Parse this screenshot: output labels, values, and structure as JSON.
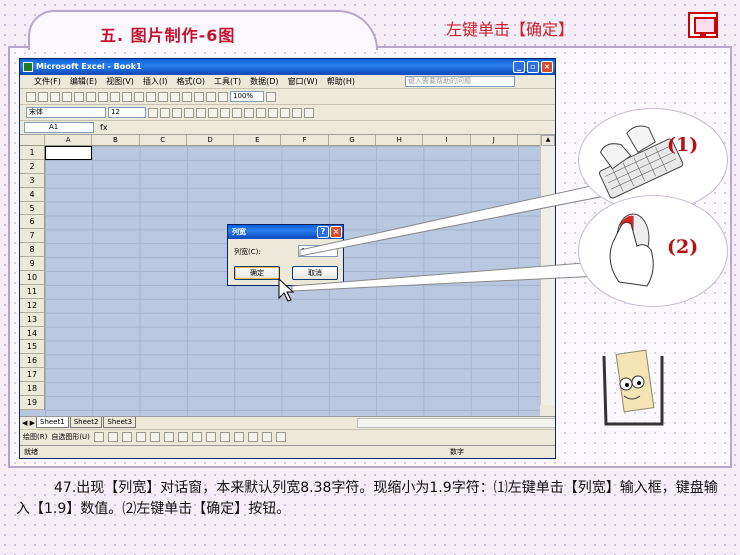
{
  "header": {
    "title": "五. 图片制作-6图",
    "tip": "左键单击【确定】"
  },
  "excel": {
    "title": "Microsoft Excel - Book1",
    "menu": [
      "文件(F)",
      "编辑(E)",
      "视图(V)",
      "插入(I)",
      "格式(O)",
      "工具(T)",
      "数据(D)",
      "窗口(W)",
      "帮助(H)"
    ],
    "help_placeholder": "键入需要帮助的问题",
    "zoom": "100%",
    "font": "宋体",
    "font_size": "12",
    "name_box": "A1",
    "fx": "fx",
    "columns": [
      "A",
      "B",
      "C",
      "D",
      "E",
      "F",
      "G",
      "H",
      "I",
      "J"
    ],
    "rows": [
      "1",
      "2",
      "3",
      "4",
      "5",
      "6",
      "7",
      "8",
      "9",
      "10",
      "11",
      "12",
      "13",
      "14",
      "15",
      "16",
      "17",
      "18",
      "19"
    ],
    "sheets": [
      "Sheet1",
      "Sheet2",
      "Sheet3"
    ],
    "draw_label": "绘图(R)",
    "autoshape_label": "自选图形(U)",
    "status_left": "就绪",
    "status_right": "数字"
  },
  "dialog": {
    "title": "列宽",
    "label": "列宽(C):",
    "value": "1.9",
    "ok": "确定",
    "cancel": "取消"
  },
  "callouts": {
    "n1": "(1)",
    "n2": "(2)"
  },
  "caption": "47.出现【列宽】对话窗，本来默认列宽8.38字符。现缩小为1.9字符：⑴左键单击【列宽】输入框，键盘输入【1.9】数值。⑵左键单击【确定】按钮。"
}
